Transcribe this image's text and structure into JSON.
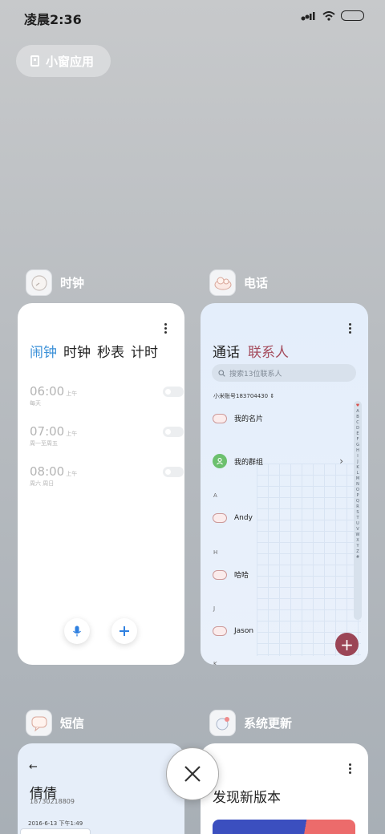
{
  "status_bar": {
    "time": "凌晨2:36"
  },
  "small_window": {
    "label": "小窗应用"
  },
  "cards": {
    "clock": {
      "app_name": "时钟",
      "tabs": [
        "闹钟",
        "时钟",
        "秒表",
        "计时"
      ],
      "alarms": [
        {
          "time": "06:00",
          "ampm": "上午",
          "repeat": "每天"
        },
        {
          "time": "07:00",
          "ampm": "上午",
          "repeat": "周一至周五"
        },
        {
          "time": "08:00",
          "ampm": "上午",
          "repeat": "周六 周日"
        }
      ]
    },
    "phone": {
      "app_name": "电话",
      "tabs": [
        "通话",
        "联系人"
      ],
      "search_placeholder": "搜索13位联系人",
      "account": "小米账号183704430",
      "my_card": "我的名片",
      "my_groups": "我的群组",
      "sections": [
        {
          "letter": "A",
          "name": "Andy"
        },
        {
          "letter": "H",
          "name": "哈哈"
        },
        {
          "letter": "J",
          "name": "Jason"
        }
      ],
      "next_letter": "K",
      "index_letters": [
        "♥",
        "A",
        "B",
        "C",
        "D",
        "E",
        "F",
        "G",
        "H",
        "I",
        "J",
        "K",
        "L",
        "M",
        "N",
        "O",
        "P",
        "Q",
        "R",
        "S",
        "T",
        "U",
        "V",
        "W",
        "X",
        "Y",
        "Z",
        "#"
      ],
      "add_symbol": "+"
    },
    "sms": {
      "app_name": "短信",
      "contact_name": "倩倩",
      "number": "18730218809",
      "date": "2016-6-13 下午1:49"
    },
    "update": {
      "app_name": "系统更新",
      "title": "发现新版本"
    }
  },
  "colors": {
    "clock_accent": "#3a90d8",
    "phone_accent": "#a44a5b",
    "fab": "#9b4556"
  }
}
